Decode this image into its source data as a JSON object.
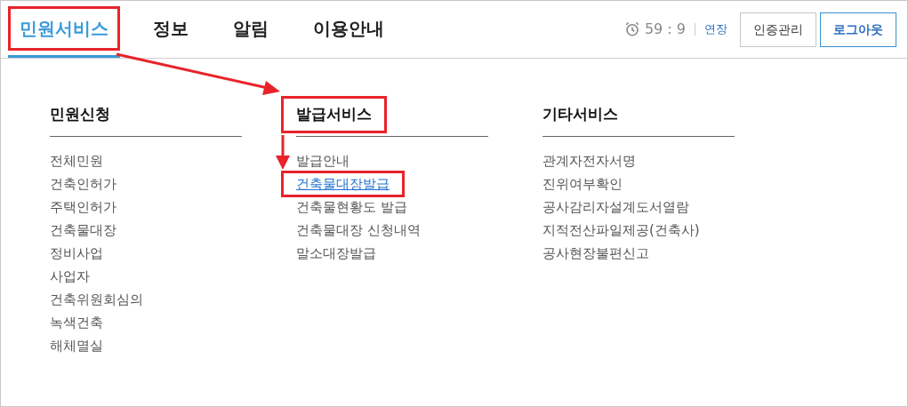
{
  "nav": [
    {
      "label": "민원서비스",
      "selected": true,
      "highlighted": true
    },
    {
      "label": "정보",
      "selected": false,
      "highlighted": false
    },
    {
      "label": "알림",
      "selected": false,
      "highlighted": false
    },
    {
      "label": "이용안내",
      "selected": false,
      "highlighted": false
    }
  ],
  "session": {
    "timer": "59 : 9",
    "extend": "연장",
    "buttons": [
      {
        "label": "인증관리",
        "kind": "plain"
      },
      {
        "label": "로그아웃",
        "kind": "primary"
      }
    ]
  },
  "columns": [
    {
      "title": "민원신청",
      "highlighted": false,
      "items": [
        {
          "label": "전체민원",
          "selected": false
        },
        {
          "label": "건축인허가",
          "selected": false
        },
        {
          "label": "주택인허가",
          "selected": false
        },
        {
          "label": "건축물대장",
          "selected": false
        },
        {
          "label": "정비사업",
          "selected": false
        },
        {
          "label": "사업자",
          "selected": false
        },
        {
          "label": "건축위원회심의",
          "selected": false
        },
        {
          "label": "녹색건축",
          "selected": false
        },
        {
          "label": "해체멸실",
          "selected": false
        }
      ]
    },
    {
      "title": "발급서비스",
      "highlighted": true,
      "items": [
        {
          "label": "발급안내",
          "selected": false
        },
        {
          "label": "건축물대장발급",
          "selected": true
        },
        {
          "label": "건축물현황도 발급",
          "selected": false
        },
        {
          "label": "건축물대장 신청내역",
          "selected": false
        },
        {
          "label": "말소대장발급",
          "selected": false
        }
      ]
    },
    {
      "title": "기타서비스",
      "highlighted": false,
      "items": [
        {
          "label": "관계자전자서명",
          "selected": false
        },
        {
          "label": "진위여부확인",
          "selected": false
        },
        {
          "label": "공사감리자설계도서열람",
          "selected": false
        },
        {
          "label": "지적전산파일제공(건축사)",
          "selected": false
        },
        {
          "label": "공사현장불편신고",
          "selected": false
        }
      ]
    }
  ]
}
